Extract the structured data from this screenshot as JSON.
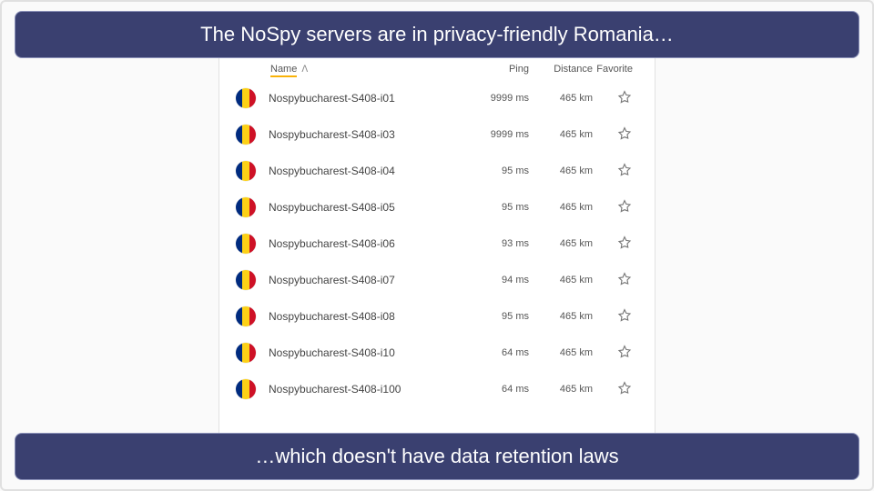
{
  "banner_top": "The NoSpy servers are in privacy-friendly Romania…",
  "banner_bottom": "…which doesn't have data retention laws",
  "headers": {
    "name": "Name",
    "ping": "Ping",
    "distance": "Distance",
    "favorite": "Favorite"
  },
  "sort_indicator": "ᐱ",
  "servers": [
    {
      "name": "Nospybucharest-S408-i01",
      "ping": "9999 ms",
      "distance": "465 km"
    },
    {
      "name": "Nospybucharest-S408-i03",
      "ping": "9999 ms",
      "distance": "465 km"
    },
    {
      "name": "Nospybucharest-S408-i04",
      "ping": "95 ms",
      "distance": "465 km"
    },
    {
      "name": "Nospybucharest-S408-i05",
      "ping": "95 ms",
      "distance": "465 km"
    },
    {
      "name": "Nospybucharest-S408-i06",
      "ping": "93 ms",
      "distance": "465 km"
    },
    {
      "name": "Nospybucharest-S408-i07",
      "ping": "94 ms",
      "distance": "465 km"
    },
    {
      "name": "Nospybucharest-S408-i08",
      "ping": "95 ms",
      "distance": "465 km"
    },
    {
      "name": "Nospybucharest-S408-i10",
      "ping": "64 ms",
      "distance": "465 km"
    },
    {
      "name": "Nospybucharest-S408-i100",
      "ping": "64 ms",
      "distance": "465 km"
    }
  ]
}
